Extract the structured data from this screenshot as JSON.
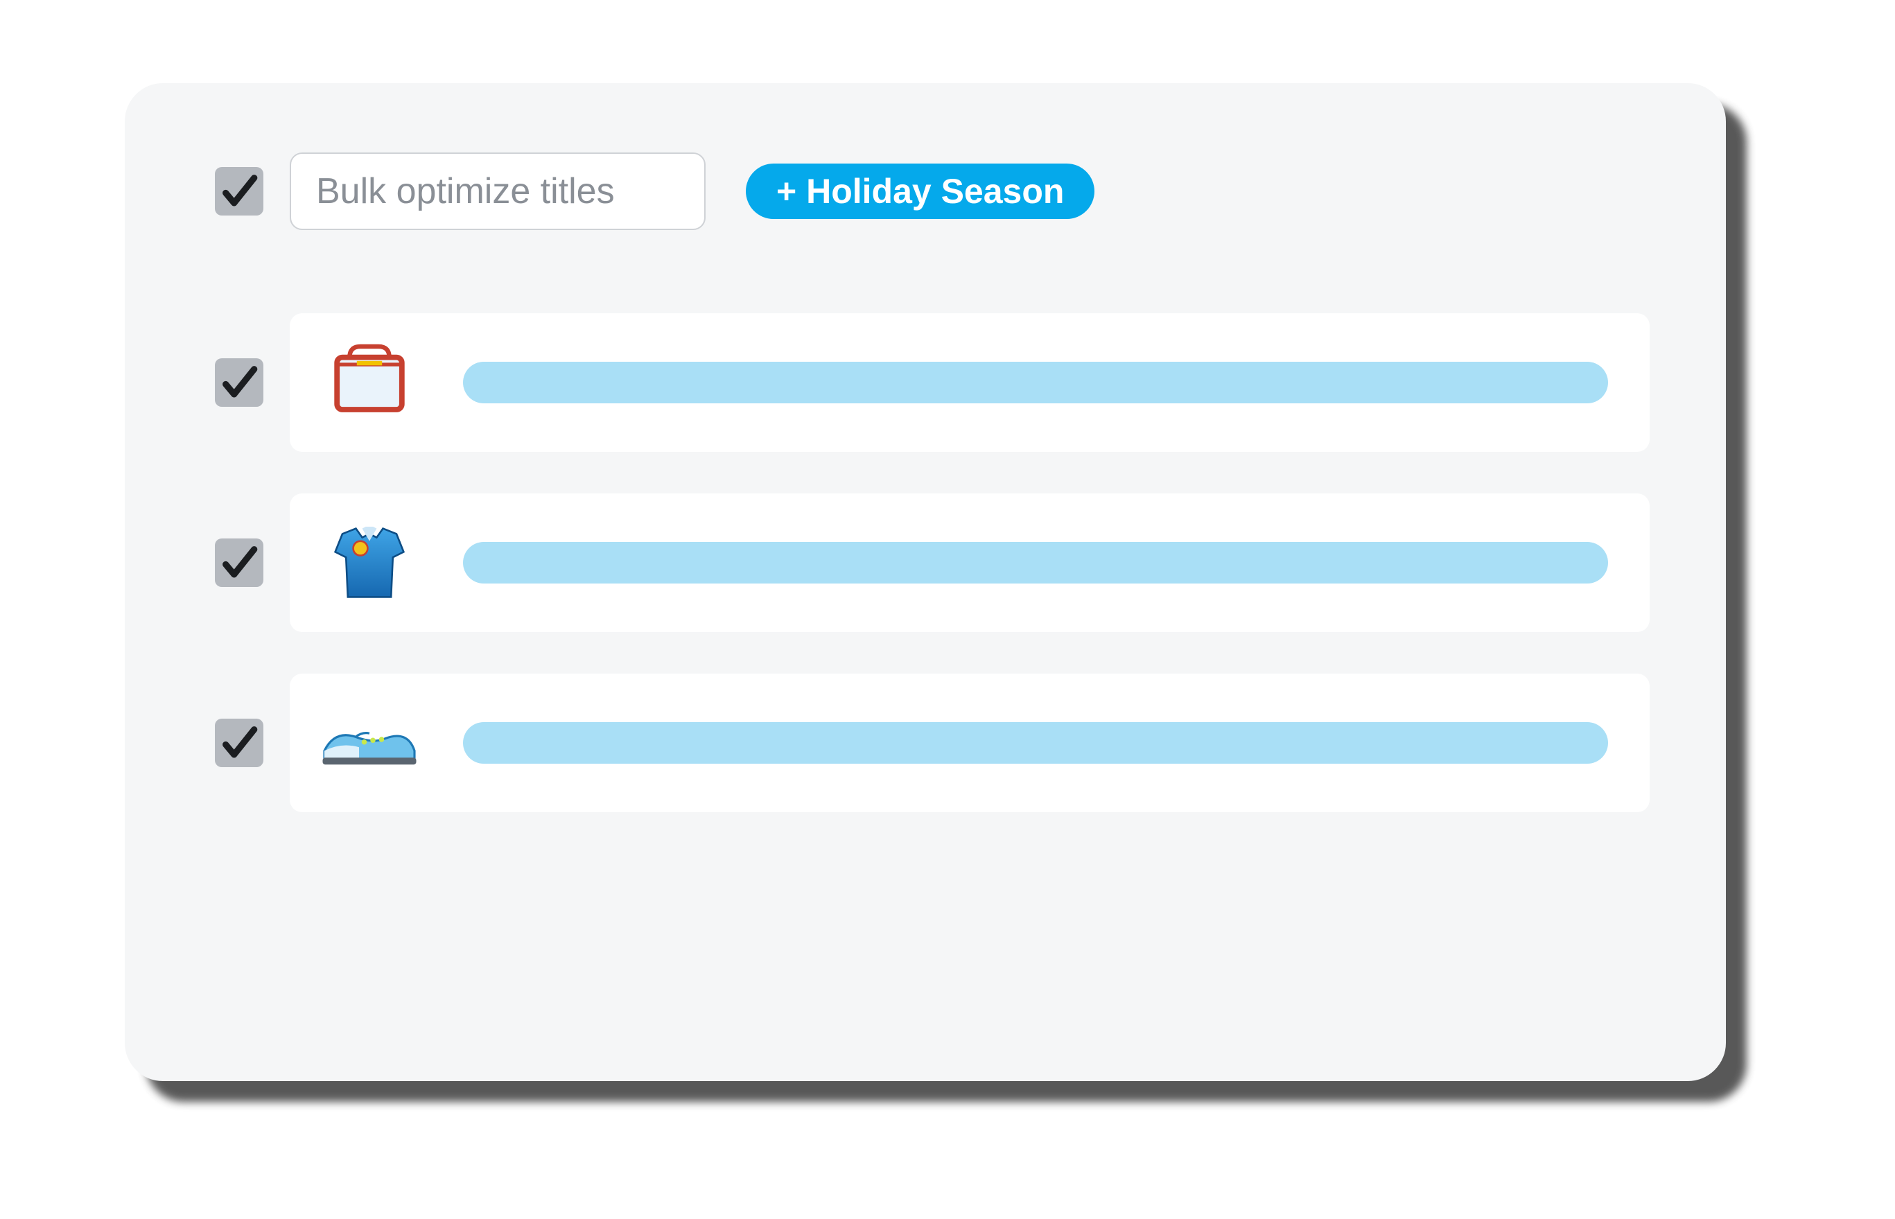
{
  "header": {
    "select_all_checked": true,
    "input_placeholder": "Bulk optimize titles",
    "pill_label": "+ Holiday Season"
  },
  "items": [
    {
      "icon": "bag-icon",
      "checked": true
    },
    {
      "icon": "polo-shirt-icon",
      "checked": true
    },
    {
      "icon": "sneaker-icon",
      "checked": true
    }
  ],
  "colors": {
    "accent": "#05a9eb",
    "bar": "#a9dff6",
    "panel": "#f5f6f7",
    "checkbox": "#b4b8be"
  }
}
